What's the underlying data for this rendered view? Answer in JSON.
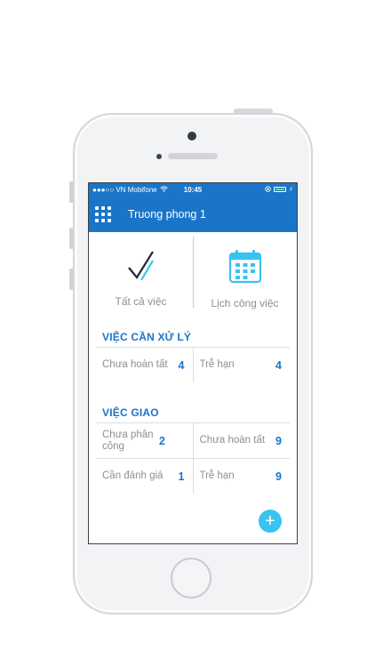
{
  "status_bar": {
    "carrier": "●●●○○ VN Mobifone",
    "time": "10:45"
  },
  "header": {
    "title": "Truong phong 1"
  },
  "tiles": [
    {
      "label": "Tất cả việc",
      "icon": "checkmark-icon"
    },
    {
      "label": "Lịch công việc",
      "icon": "calendar-icon"
    }
  ],
  "sections": {
    "can_xu_ly": {
      "title": "VIỆC CẦN XỬ LÝ",
      "rows": [
        [
          {
            "label": "Chưa hoàn tất",
            "count": "4"
          },
          {
            "label": "Trễ hạn",
            "count": "4"
          }
        ]
      ]
    },
    "giao": {
      "title": "VIỆC GIAO",
      "rows": [
        [
          {
            "label": "Chưa phân công",
            "count": "2"
          },
          {
            "label": "Chưa hoàn tất",
            "count": "9"
          }
        ],
        [
          {
            "label": "Cần đánh giá",
            "count": "1"
          },
          {
            "label": "Trễ hạn",
            "count": "9"
          }
        ]
      ]
    }
  },
  "fab": {
    "label": "+"
  },
  "colors": {
    "primary": "#1a75c8",
    "fab": "#38c3f0",
    "muted_text": "#8a8f95"
  }
}
